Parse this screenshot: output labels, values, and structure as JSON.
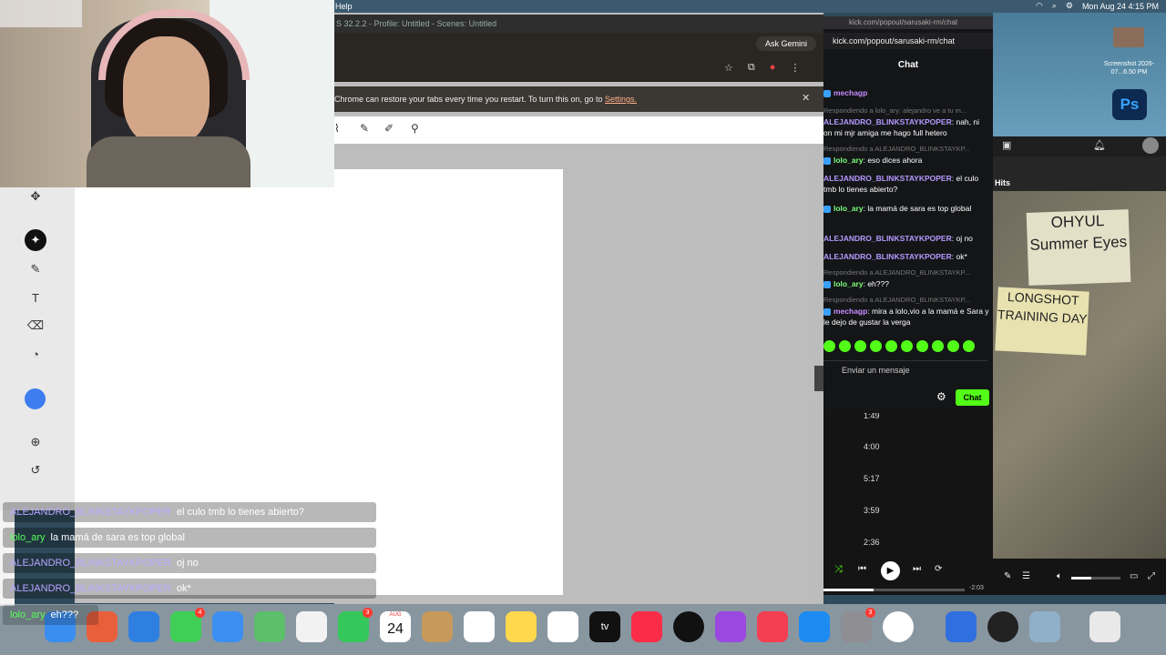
{
  "menubar": {
    "help": "Help",
    "datetime": "Mon Aug 24  4:15 PM"
  },
  "obs": {
    "title": "S 32.2.2 - Profile: Untitled - Scenes: Untitled"
  },
  "chrome": {
    "ask_gemini": "Ask Gemini",
    "restore_text": "Chrome can restore your tabs every time you restart. To turn this on, go to",
    "restore_link": "Settings."
  },
  "overlay": [
    {
      "user": "ALEJANDRO_BLINKSTAYKPOPER",
      "msg": "el culo tmb lo tienes abierto?",
      "green": false
    },
    {
      "user": "lolo_ary",
      "msg": "la mamá de sara es top global",
      "green": true
    },
    {
      "user": "ALEJANDRO_BLINKSTAYKPOPER",
      "msg": "oj no",
      "green": false
    },
    {
      "user": "ALEJANDRO_BLINKSTAYKPOPER",
      "msg": "ok*",
      "green": false
    },
    {
      "user": "lolo_ary",
      "msg": "eh???",
      "green": true
    }
  ],
  "kick": {
    "url_top": "kick.com/popout/sarusaki-rm/chat",
    "url": "kick.com/popout/sarusaki-rm/chat",
    "header": "Chat",
    "messages": [
      {
        "reply": "",
        "user": "mechagp",
        "text": "",
        "color": "p"
      },
      {
        "reply": "Respondiendo a lolo_ary: alejandro ve a tu m...",
        "user": "ALEJANDRO_BLINKSTAYKPOPER",
        "text": ": nah, ni on mi mjr amiga me hago full hetero",
        "color": ""
      },
      {
        "reply": "Respondiendo a ALEJANDRO_BLINKSTAYKP...",
        "user": "lolo_ary",
        "text": ": eso dices ahora",
        "color": "g"
      },
      {
        "reply": "",
        "user": "ALEJANDRO_BLINKSTAYKPOPER",
        "text": ": el culo tmb lo tienes abierto?",
        "color": ""
      },
      {
        "reply": "",
        "user": "lolo_ary",
        "text": ": la mamá de sara es top global",
        "color": "g"
      },
      {
        "reply": "",
        "user": "ALEJANDRO_BLINKSTAYKPOPER",
        "text": ": oj no",
        "color": ""
      },
      {
        "reply": "",
        "user": "ALEJANDRO_BLINKSTAYKPOPER",
        "text": ": ok*",
        "color": ""
      },
      {
        "reply": "Respondiendo a ALEJANDRO_BLINKSTAYKP...",
        "user": "lolo_ary",
        "text": ": eh???",
        "color": "g"
      },
      {
        "reply": "Respondiendo a ALEJANDRO_BLINKSTAYKP...",
        "user": "mechagp",
        "text": ": mira a lolo,vio a la mamá e Sara y le dejo de gustar la verga",
        "color": "p"
      }
    ],
    "input_placeholder": "Enviar un mensaje",
    "chat_button": "Chat"
  },
  "music": {
    "durations": [
      "1:49",
      "4:00",
      "5:17",
      "3:59",
      "2:36"
    ],
    "remaining": "-2:03",
    "progress": 0.35,
    "volume": 0.4
  },
  "right": {
    "hits": "Hits",
    "note1": "OHYUL Summer Eyes",
    "note2": "LONGSHOT TRAINING DAY"
  },
  "desktop": {
    "screenshot_label": "Screenshot 2026-07...6.50 PM",
    "ps": "Ps"
  },
  "dock": {
    "cal_month": "AUG",
    "cal_day": "24",
    "atv": "tv",
    "badges": {
      "messages": "4",
      "facetime": "3",
      "settings": "3"
    }
  }
}
